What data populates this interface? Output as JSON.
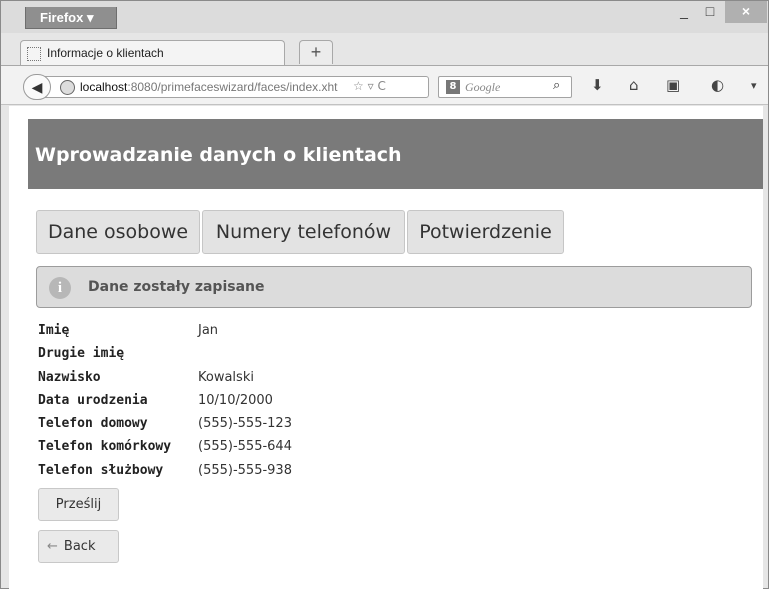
{
  "browser": {
    "menu_button": "Firefox ▾",
    "window_controls": {
      "minimize": "_",
      "maximize": "□",
      "close": "×"
    },
    "tab": {
      "title": "Informacje o klientach"
    },
    "new_tab": "+",
    "url": {
      "host": "localhost",
      "rest": ":8080/primefaceswizard/faces/index.xht"
    },
    "search": {
      "engine_badge": "8",
      "placeholder": "Google"
    },
    "icons": [
      "back-arrow-icon",
      "globe-icon",
      "star-icon",
      "reload-icon",
      "search-icon",
      "download-icon",
      "home-icon",
      "bookmarks-icon",
      "addon-icon",
      "menu-icon"
    ]
  },
  "page": {
    "header": "Wprowadzanie danych o klientach",
    "wizard_tabs": [
      "Dane osobowe",
      "Numery telefonów",
      "Potwierdzenie"
    ],
    "message": {
      "icon": "i",
      "text": "Dane zostały zapisane"
    },
    "summary": [
      {
        "label": "Imię",
        "value": "Jan"
      },
      {
        "label": "Drugie imię",
        "value": ""
      },
      {
        "label": "Nazwisko",
        "value": "Kowalski"
      },
      {
        "label": "Data urodzenia",
        "value": "10/10/2000"
      },
      {
        "label": "Telefon domowy",
        "value": "(555)-555-123"
      },
      {
        "label": "Telefon komórkowy",
        "value": "(555)-555-644"
      },
      {
        "label": "Telefon służbowy",
        "value": "(555)-555-938"
      }
    ],
    "buttons": {
      "submit": "Prześlij",
      "back_arrow": "←",
      "back": "Back"
    }
  }
}
